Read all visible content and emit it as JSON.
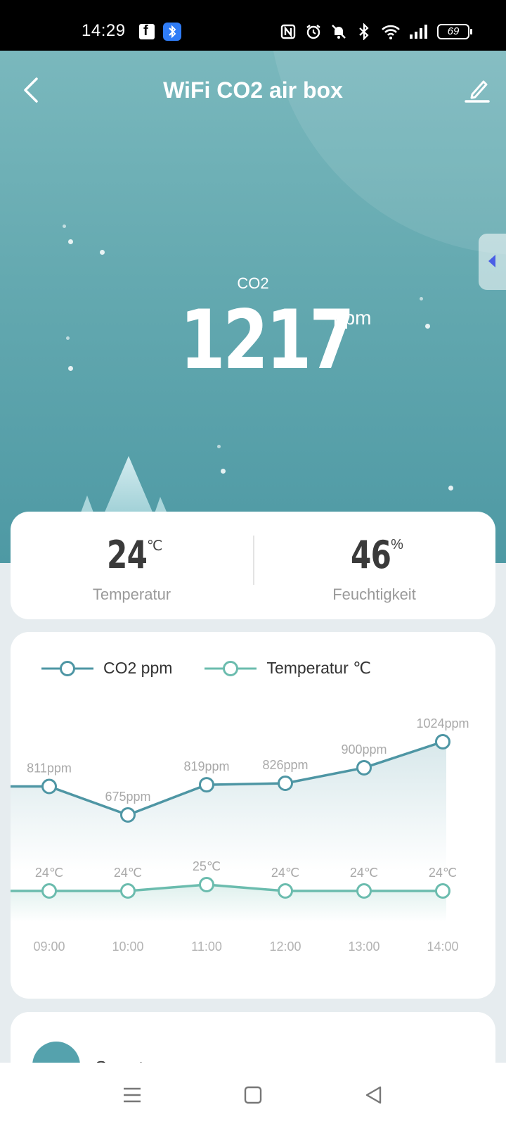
{
  "status_bar": {
    "time": "14:29",
    "battery": "69"
  },
  "header": {
    "title": "WiFi CO2 air box"
  },
  "co2": {
    "label": "CO2",
    "value": "1217",
    "unit": "ppm"
  },
  "stats": {
    "temperature": {
      "value": "24",
      "unit": "℃",
      "label": "Temperatur"
    },
    "humidity": {
      "value": "46",
      "unit": "%",
      "label": "Feuchtigkeit"
    }
  },
  "colors": {
    "co2_line": "#4e96a4",
    "temp_line": "#6bbcae",
    "hero_top": "#7ab8bd",
    "hero_bottom": "#4e99a4"
  },
  "chart_data": {
    "type": "line",
    "categories": [
      "09:00",
      "10:00",
      "11:00",
      "12:00",
      "13:00",
      "14:00"
    ],
    "series": [
      {
        "name": "CO2 ppm",
        "values": [
          811,
          675,
          819,
          826,
          900,
          1024
        ],
        "labels": [
          "811ppm",
          "675ppm",
          "819ppm",
          "826ppm",
          "900ppm",
          "1024ppm"
        ]
      },
      {
        "name": "Temperatur ℃",
        "values": [
          24,
          24,
          25,
          24,
          24,
          24
        ],
        "labels": [
          "24℃",
          "24℃",
          "25℃",
          "24℃",
          "24℃",
          "24℃"
        ]
      }
    ],
    "title": "",
    "xlabel": "",
    "ylabel": "",
    "legend": "top-left",
    "grid": false
  },
  "bottom_card": {
    "text": "Smart"
  },
  "icons": {
    "back": "chevron-left-icon",
    "edit": "pencil-icon",
    "side_tab": "triangle-left-icon",
    "nav_menu": "menu-icon",
    "nav_home": "square-icon",
    "nav_back": "triangle-back-icon"
  }
}
